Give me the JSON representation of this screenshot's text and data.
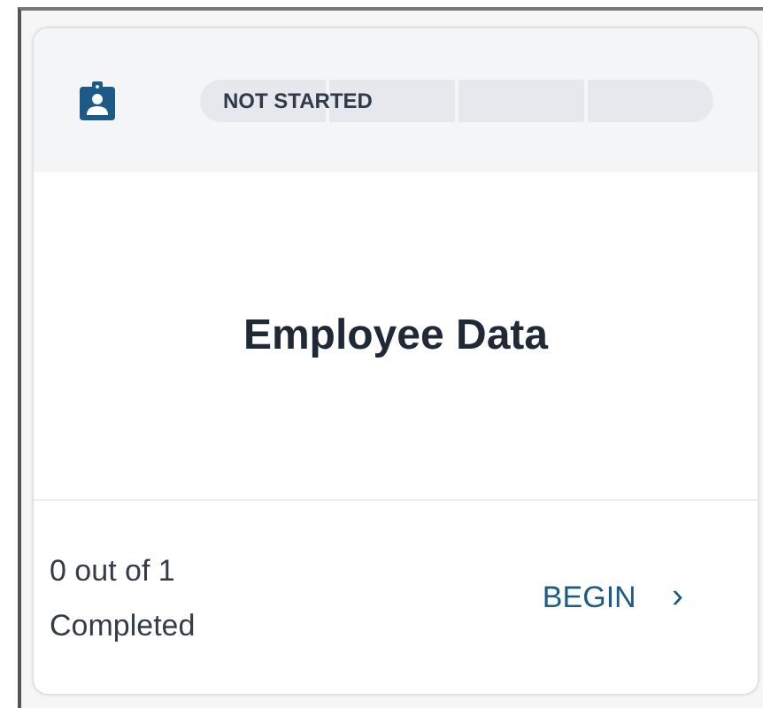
{
  "card": {
    "status": "NOT STARTED",
    "title": "Employee Data",
    "progress_text": "0 out of 1\nCompleted",
    "action": "BEGIN",
    "action_icon": "›"
  }
}
